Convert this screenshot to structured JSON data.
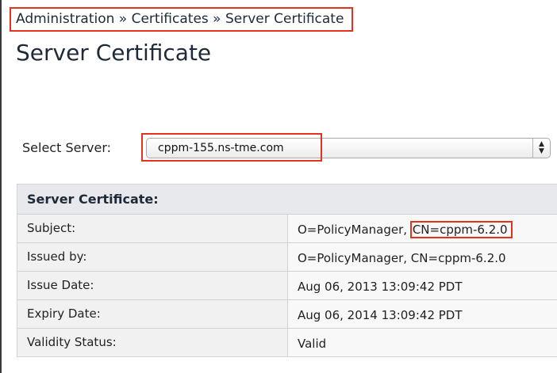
{
  "breadcrumb": {
    "items": [
      "Administration",
      "Certificates",
      "Server Certificate"
    ],
    "text": "Administration » Certificates » Server Certificate"
  },
  "page": {
    "title": "Server Certificate"
  },
  "server_select": {
    "label": "Select Server:",
    "value": "cppm-155.ns-tme.com",
    "arrow_glyph": "▲▼"
  },
  "certificate": {
    "section_title": "Server Certificate:",
    "rows": [
      {
        "label": "Subject:",
        "value_prefix": "O=PolicyManager, ",
        "value_highlight": "CN=cppm-6.2.0"
      },
      {
        "label": "Issued by:",
        "value": "O=PolicyManager, CN=cppm-6.2.0"
      },
      {
        "label": "Issue Date:",
        "value": "Aug 06, 2013 13:09:42 PDT"
      },
      {
        "label": "Expiry Date:",
        "value": "Aug 06, 2014 13:09:42 PDT"
      },
      {
        "label": "Validity Status:",
        "value": "Valid"
      }
    ]
  },
  "colors": {
    "highlight": "#e2341d",
    "header_bg": "#e7e9ed",
    "text_dark": "#1f2a38"
  }
}
